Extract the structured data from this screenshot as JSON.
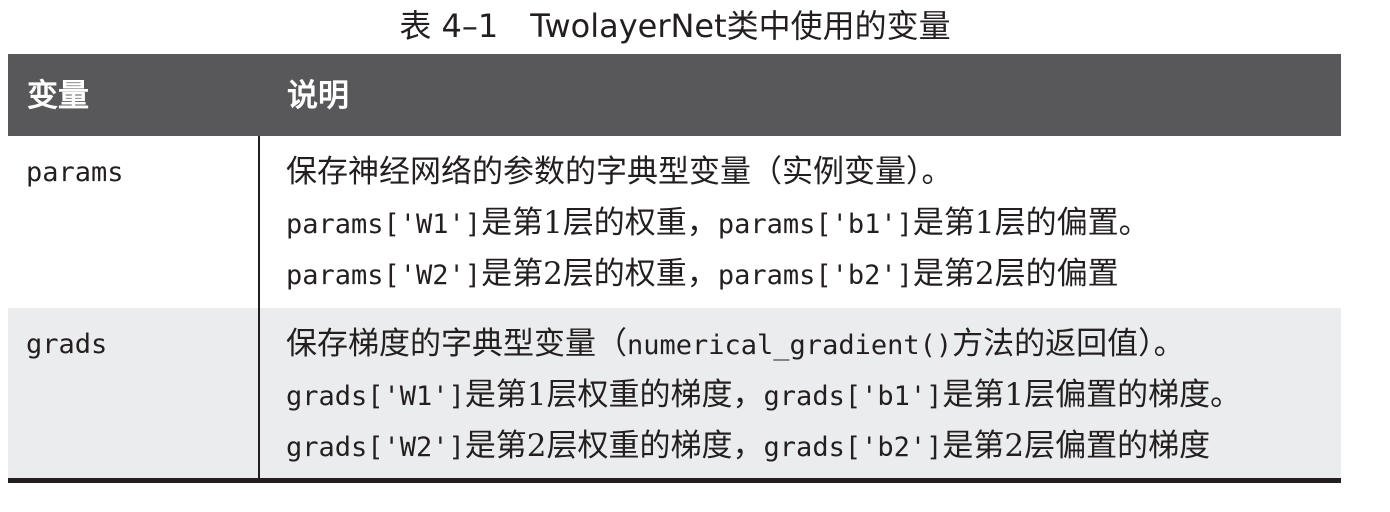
{
  "caption": "表 4–1　TwolayerNet类中使用的变量",
  "header": {
    "col1": "变量",
    "col2": "说明"
  },
  "rows": [
    {
      "name": "params",
      "lines": [
        {
          "pre": "保存神经网络的参数的字典型变量（实例变量）。"
        },
        {
          "c1": "params['W1']",
          "t1": "是第1层的权重，",
          "c2": "params['b1']",
          "t2": "是第1层的偏置。"
        },
        {
          "c1": "params['W2']",
          "t1": "是第2层的权重，",
          "c2": "params['b2']",
          "t2": "是第2层的偏置"
        }
      ]
    },
    {
      "name": "grads",
      "lines": [
        {
          "pre": "保存梯度的字典型变量（",
          "code": "numerical_gradient()",
          "post": "方法的返回值）。"
        },
        {
          "c1": "grads['W1']",
          "t1": "是第1层权重的梯度，",
          "c2": "grads['b1']",
          "t2": "是第1层偏置的梯度。"
        },
        {
          "c1": "grads['W2']",
          "t1": "是第2层权重的梯度，",
          "c2": "grads['b2']",
          "t2": "是第2层偏置的梯度"
        }
      ]
    }
  ],
  "colors": {
    "header_bg": "#58585a",
    "header_text": "#ffffff",
    "row_alt_bg": "#ebeced",
    "rule": "#231f20",
    "text": "#231f20"
  }
}
